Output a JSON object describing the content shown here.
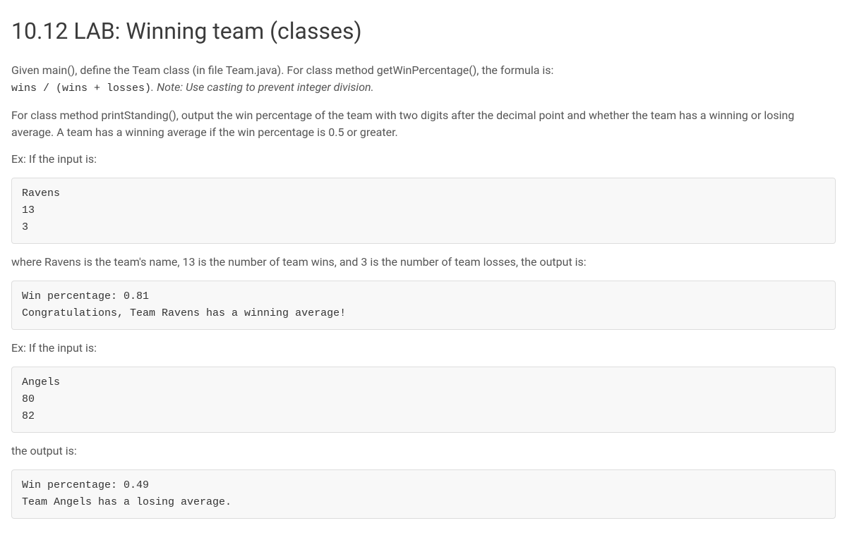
{
  "title": "10.12 LAB: Winning team (classes)",
  "para1": {
    "text1": "Given main(), define the Team class (in file Team.java). For class method getWinPercentage(), the formula is:",
    "code": "wins / (wins + losses)",
    "note": ". Note: Use casting to prevent integer division."
  },
  "para2": "For class method printStanding(), output the win percentage of the team with two digits after the decimal point and whether the team has a winning or losing average. A team has a winning average if the win percentage is 0.5 or greater.",
  "exLabel1": "Ex: If the input is:",
  "codeblock1": "Ravens\n13\n3",
  "para3": "where Ravens is the team's name, 13 is the number of team wins, and 3 is the number of team losses, the output is:",
  "codeblock2": "Win percentage: 0.81\nCongratulations, Team Ravens has a winning average!",
  "exLabel2": "Ex: If the input is:",
  "codeblock3": "Angels\n80\n82",
  "para4": "the output is:",
  "codeblock4": "Win percentage: 0.49\nTeam Angels has a losing average."
}
